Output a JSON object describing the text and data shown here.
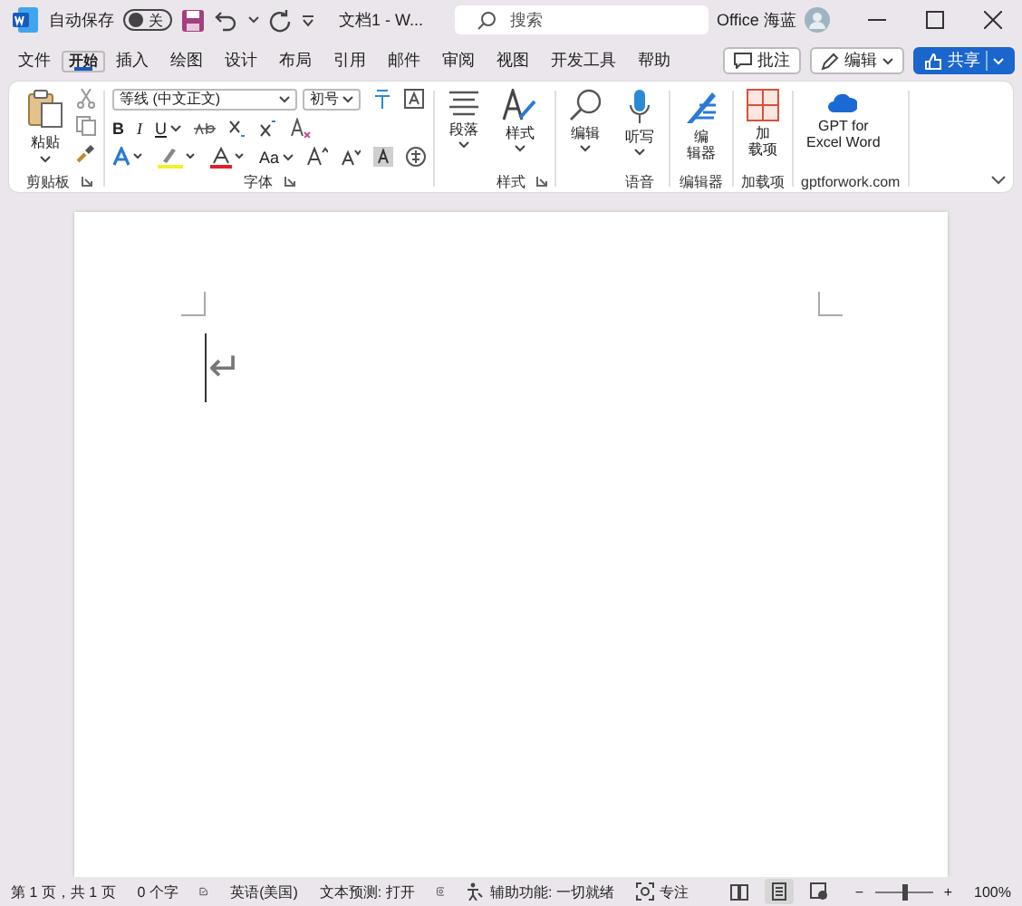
{
  "title_bar": {
    "autosave_label": "自动保存",
    "autosave": {
      "on": false,
      "label": "关"
    },
    "document_title": "文档1 - W...",
    "search_placeholder": "搜索",
    "user_name": "Office 海蓝"
  },
  "menu_tabs": [
    {
      "label": "文件",
      "selected": false
    },
    {
      "label": "开始",
      "selected": true
    },
    {
      "label": "插入",
      "selected": false
    },
    {
      "label": "绘图",
      "selected": false
    },
    {
      "label": "设计",
      "selected": false
    },
    {
      "label": "布局",
      "selected": false
    },
    {
      "label": "引用",
      "selected": false
    },
    {
      "label": "邮件",
      "selected": false
    },
    {
      "label": "审阅",
      "selected": false
    },
    {
      "label": "视图",
      "selected": false
    },
    {
      "label": "开发工具",
      "selected": false
    },
    {
      "label": "帮助",
      "selected": false
    }
  ],
  "header_buttons": [
    {
      "kind": "comment",
      "label": "批注"
    },
    {
      "kind": "edit",
      "label": "编辑"
    },
    {
      "kind": "share",
      "label": "共享"
    }
  ],
  "ribbon": {
    "clipboard": {
      "paste": "粘贴",
      "group_label": "剪贴板"
    },
    "font": {
      "font_name": "等线 (中文正文)",
      "font_size": "初号",
      "bold": "B",
      "italic": "I",
      "underline": "U",
      "change_case": "Aa",
      "group_label": "字体"
    },
    "tools": [
      {
        "kind": "paragraph",
        "lines": [
          "段落"
        ],
        "dropdown": true
      },
      {
        "kind": "styles",
        "lines": [
          "样式"
        ],
        "dropdown": true,
        "group_label": "样式"
      },
      {
        "kind": "editing",
        "lines": [
          "编辑"
        ],
        "dropdown": true
      },
      {
        "kind": "dictate",
        "lines": [
          "听写"
        ],
        "dropdown": true,
        "group_label": "语音"
      },
      {
        "kind": "editor",
        "lines": [
          "编",
          "辑器"
        ],
        "dropdown": false,
        "group_label": "编辑器"
      },
      {
        "kind": "addins",
        "lines": [
          "加",
          "载项"
        ],
        "dropdown": false,
        "group_label": "加载项"
      },
      {
        "kind": "gpt",
        "lines": [
          "GPT for",
          "Excel Word"
        ],
        "dropdown": false,
        "group_label": "gptforwork.com"
      }
    ]
  },
  "document": {
    "paragraph_mark": "↵"
  },
  "status_bar": {
    "page": "第 1 页，共 1 页",
    "words": "0 个字",
    "language": "英语(美国)",
    "text_prediction": "文本预测: 打开",
    "accessibility": "辅助功能: 一切就绪",
    "focus": "专注",
    "views": [
      {
        "kind": "read",
        "selected": false
      },
      {
        "kind": "print",
        "selected": true
      },
      {
        "kind": "web",
        "selected": false
      }
    ],
    "zoom": {
      "zoom_out": "−",
      "zoom_in": "+",
      "level": 0.5,
      "label": "100%"
    }
  }
}
